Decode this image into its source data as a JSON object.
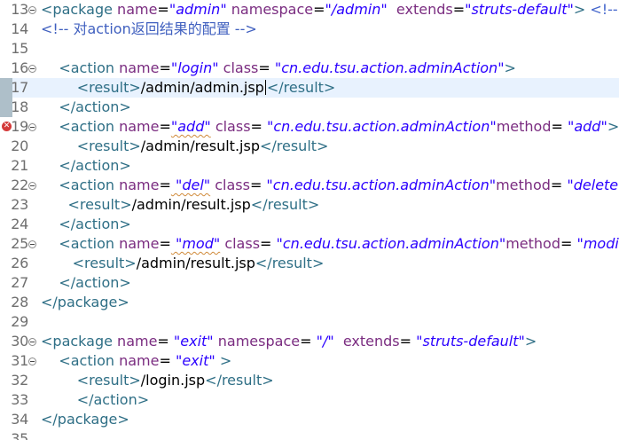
{
  "editor": {
    "lines": [
      {
        "num": "13",
        "indent": "",
        "fold": true,
        "marker": false,
        "current": false,
        "error": false,
        "tokens": [
          [
            "t",
            "<package "
          ],
          [
            "a",
            "name"
          ],
          [
            "x",
            "="
          ],
          [
            "v",
            "\"admin\""
          ],
          [
            "x",
            " "
          ],
          [
            "a",
            "namespace"
          ],
          [
            "x",
            "="
          ],
          [
            "v",
            "\"/admin\""
          ],
          [
            "x",
            "  "
          ],
          [
            "a",
            "extends"
          ],
          [
            "x",
            "="
          ],
          [
            "v",
            "\"struts-default\""
          ],
          [
            "t",
            ">"
          ],
          [
            "c",
            " <!-- 定义一"
          ]
        ]
      },
      {
        "num": "14",
        "indent": "",
        "fold": false,
        "marker": false,
        "current": false,
        "error": false,
        "tokens": [
          [
            "cn",
            "<!-- 对action返回结果的配置 -->"
          ]
        ]
      },
      {
        "num": "15",
        "indent": "",
        "fold": false,
        "marker": false,
        "current": false,
        "error": false,
        "tokens": []
      },
      {
        "num": "16",
        "indent": "    ",
        "fold": true,
        "marker": false,
        "current": false,
        "error": false,
        "tokens": [
          [
            "t",
            "<action "
          ],
          [
            "a",
            "name"
          ],
          [
            "x",
            "="
          ],
          [
            "v",
            "\"login\""
          ],
          [
            "x",
            " "
          ],
          [
            "a",
            "class"
          ],
          [
            "x",
            "="
          ],
          [
            "v",
            " \"cn.edu.tsu.action.adminAction\""
          ],
          [
            "t",
            ">"
          ]
        ]
      },
      {
        "num": "17",
        "indent": "        ",
        "fold": false,
        "marker": true,
        "current": true,
        "error": false,
        "tokens": [
          [
            "t",
            "<result>"
          ],
          [
            "x",
            "/admin/admin.jsp"
          ],
          [
            "caret",
            ""
          ],
          [
            "t",
            "</result>"
          ]
        ]
      },
      {
        "num": "18",
        "indent": "    ",
        "fold": false,
        "marker": true,
        "current": false,
        "error": false,
        "tokens": [
          [
            "t",
            "</action>"
          ]
        ]
      },
      {
        "num": "19",
        "indent": "    ",
        "fold": true,
        "marker": false,
        "current": false,
        "error": true,
        "tokens": [
          [
            "t",
            "<action "
          ],
          [
            "a",
            "name"
          ],
          [
            "x",
            "="
          ],
          [
            "v",
            "\"add\""
          ],
          [
            "x",
            " "
          ],
          [
            "a",
            "class"
          ],
          [
            "x",
            "="
          ],
          [
            "v",
            " \"cn.edu.tsu.action.adminAction\""
          ],
          [
            "a",
            "method"
          ],
          [
            "x",
            "="
          ],
          [
            "v",
            " \"add\""
          ],
          [
            "t",
            ">"
          ]
        ]
      },
      {
        "num": "20",
        "indent": "        ",
        "fold": false,
        "marker": false,
        "current": false,
        "error": false,
        "tokens": [
          [
            "t",
            "<result>"
          ],
          [
            "x",
            "/admin/result.jsp"
          ],
          [
            "t",
            "</result>"
          ]
        ]
      },
      {
        "num": "21",
        "indent": "    ",
        "fold": false,
        "marker": false,
        "current": false,
        "error": false,
        "tokens": [
          [
            "t",
            "</action>"
          ]
        ]
      },
      {
        "num": "22",
        "indent": "    ",
        "fold": true,
        "marker": false,
        "current": false,
        "error": false,
        "tokens": [
          [
            "t",
            "<action "
          ],
          [
            "a",
            "name"
          ],
          [
            "x",
            "="
          ],
          [
            "v",
            " \"del\""
          ],
          [
            "x",
            " "
          ],
          [
            "a",
            "class"
          ],
          [
            "x",
            "="
          ],
          [
            "v",
            " \"cn.edu.tsu.action.adminAction\""
          ],
          [
            "a",
            "method"
          ],
          [
            "x",
            "="
          ],
          [
            "v",
            " \"delete\""
          ],
          [
            "t",
            ">"
          ]
        ]
      },
      {
        "num": "23",
        "indent": "      ",
        "fold": false,
        "marker": false,
        "current": false,
        "error": false,
        "tokens": [
          [
            "t",
            "<result>"
          ],
          [
            "x",
            "/admin/result.jsp"
          ],
          [
            "t",
            "</result>"
          ]
        ]
      },
      {
        "num": "24",
        "indent": "    ",
        "fold": false,
        "marker": false,
        "current": false,
        "error": false,
        "tokens": [
          [
            "t",
            "</action>"
          ]
        ]
      },
      {
        "num": "25",
        "indent": "    ",
        "fold": true,
        "marker": false,
        "current": false,
        "error": false,
        "tokens": [
          [
            "t",
            "<action "
          ],
          [
            "a",
            "name"
          ],
          [
            "x",
            "="
          ],
          [
            "v",
            " \"mod\""
          ],
          [
            "x",
            " "
          ],
          [
            "a",
            "class"
          ],
          [
            "x",
            "="
          ],
          [
            "v",
            " \"cn.edu.tsu.action.adminAction\""
          ],
          [
            "a",
            "method"
          ],
          [
            "x",
            "="
          ],
          [
            "v",
            " \"modify\""
          ],
          [
            "t",
            ">"
          ]
        ]
      },
      {
        "num": "26",
        "indent": "       ",
        "fold": false,
        "marker": false,
        "current": false,
        "error": false,
        "tokens": [
          [
            "t",
            "<result>"
          ],
          [
            "x",
            "/admin/result.jsp"
          ],
          [
            "t",
            "</result>"
          ]
        ]
      },
      {
        "num": "27",
        "indent": "    ",
        "fold": false,
        "marker": false,
        "current": false,
        "error": false,
        "tokens": [
          [
            "t",
            "</action>"
          ]
        ]
      },
      {
        "num": "28",
        "indent": "",
        "fold": false,
        "marker": false,
        "current": false,
        "error": false,
        "tokens": [
          [
            "t",
            "</package>"
          ]
        ]
      },
      {
        "num": "29",
        "indent": "",
        "fold": false,
        "marker": false,
        "current": false,
        "error": false,
        "tokens": []
      },
      {
        "num": "30",
        "indent": "",
        "fold": true,
        "marker": false,
        "current": false,
        "error": false,
        "tokens": [
          [
            "t",
            "<package "
          ],
          [
            "a",
            "name"
          ],
          [
            "x",
            "="
          ],
          [
            "v",
            " \"exit\""
          ],
          [
            "x",
            " "
          ],
          [
            "a",
            "namespace"
          ],
          [
            "x",
            "="
          ],
          [
            "v",
            " \"/\""
          ],
          [
            "x",
            "  "
          ],
          [
            "a",
            "extends"
          ],
          [
            "x",
            "="
          ],
          [
            "v",
            " \"struts-default\""
          ],
          [
            "t",
            ">"
          ]
        ]
      },
      {
        "num": "31",
        "indent": "    ",
        "fold": true,
        "marker": false,
        "current": false,
        "error": false,
        "tokens": [
          [
            "t",
            "<action "
          ],
          [
            "a",
            "name"
          ],
          [
            "x",
            "="
          ],
          [
            "v",
            " \"exit\""
          ],
          [
            "x",
            " "
          ],
          [
            "t",
            ">"
          ]
        ]
      },
      {
        "num": "32",
        "indent": "        ",
        "fold": false,
        "marker": false,
        "current": false,
        "error": false,
        "tokens": [
          [
            "t",
            "<result>"
          ],
          [
            "x",
            "/login.jsp"
          ],
          [
            "t",
            "</result>"
          ]
        ]
      },
      {
        "num": "33",
        "indent": "        ",
        "fold": false,
        "marker": false,
        "current": false,
        "error": false,
        "tokens": [
          [
            "t",
            "</action>"
          ]
        ]
      },
      {
        "num": "34",
        "indent": "",
        "fold": false,
        "marker": false,
        "current": false,
        "error": false,
        "tokens": [
          [
            "t",
            "</package>"
          ]
        ]
      },
      {
        "num": "35",
        "indent": "",
        "fold": false,
        "marker": false,
        "current": false,
        "error": false,
        "tokens": []
      }
    ],
    "error_icon_label": "✕",
    "colors": {
      "tag": "#2f6f86",
      "attribute": "#7a2c80",
      "value": "#2a00ff",
      "comment": "#3f5fbf",
      "current_line": "#e8f2fe"
    }
  }
}
